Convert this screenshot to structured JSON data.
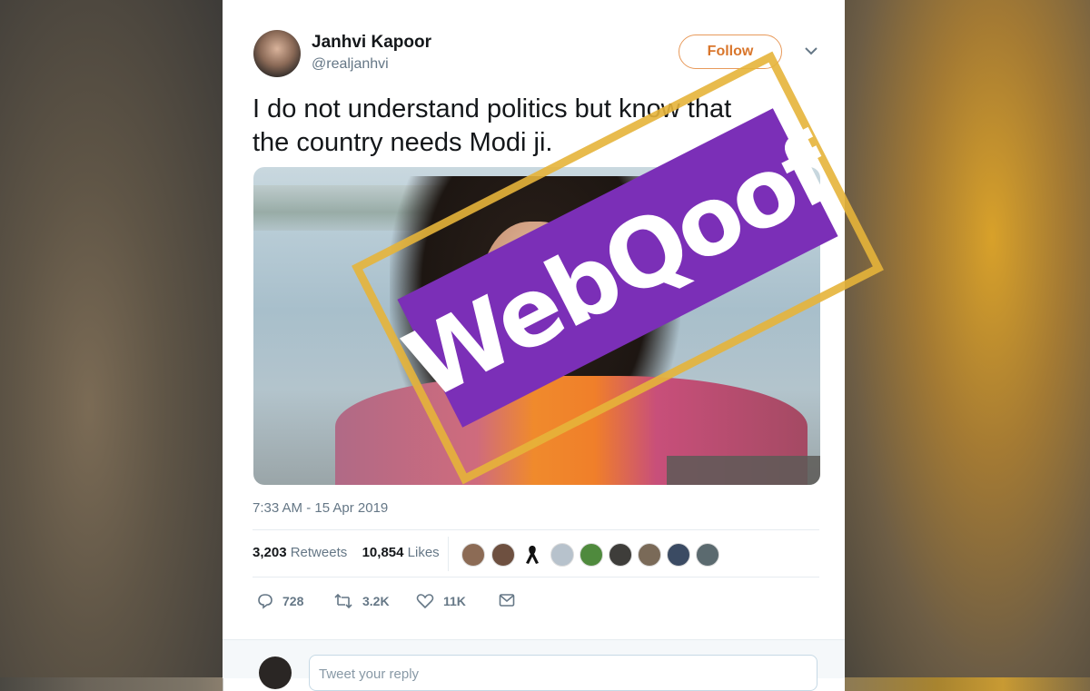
{
  "tweet": {
    "author_name": "Janhvi Kapoor",
    "handle": "@realjanhvi",
    "follow_label": "Follow",
    "text_line1": "I do not understand politics but know that",
    "text_line2": "the country needs Modi ji.",
    "timestamp": "7:33 AM - 15 Apr 2019",
    "retweets_count": "3,203",
    "retweets_label": "Retweets",
    "likes_count": "10,854",
    "likes_label": "Likes"
  },
  "actions": {
    "replies": "728",
    "retweets": "3.2K",
    "likes": "11K"
  },
  "reply": {
    "placeholder": "Tweet your reply"
  },
  "watermark": {
    "text": "WebQoof",
    "colors": {
      "purple": "#7b2fb7",
      "border": "#e6b43a"
    }
  },
  "colors": {
    "follow_accent": "#e89a5b",
    "text_primary": "#14171a",
    "text_secondary": "#657786"
  },
  "icons": [
    "chevron-down-icon",
    "reply-icon",
    "retweet-icon",
    "like-icon",
    "message-icon"
  ]
}
